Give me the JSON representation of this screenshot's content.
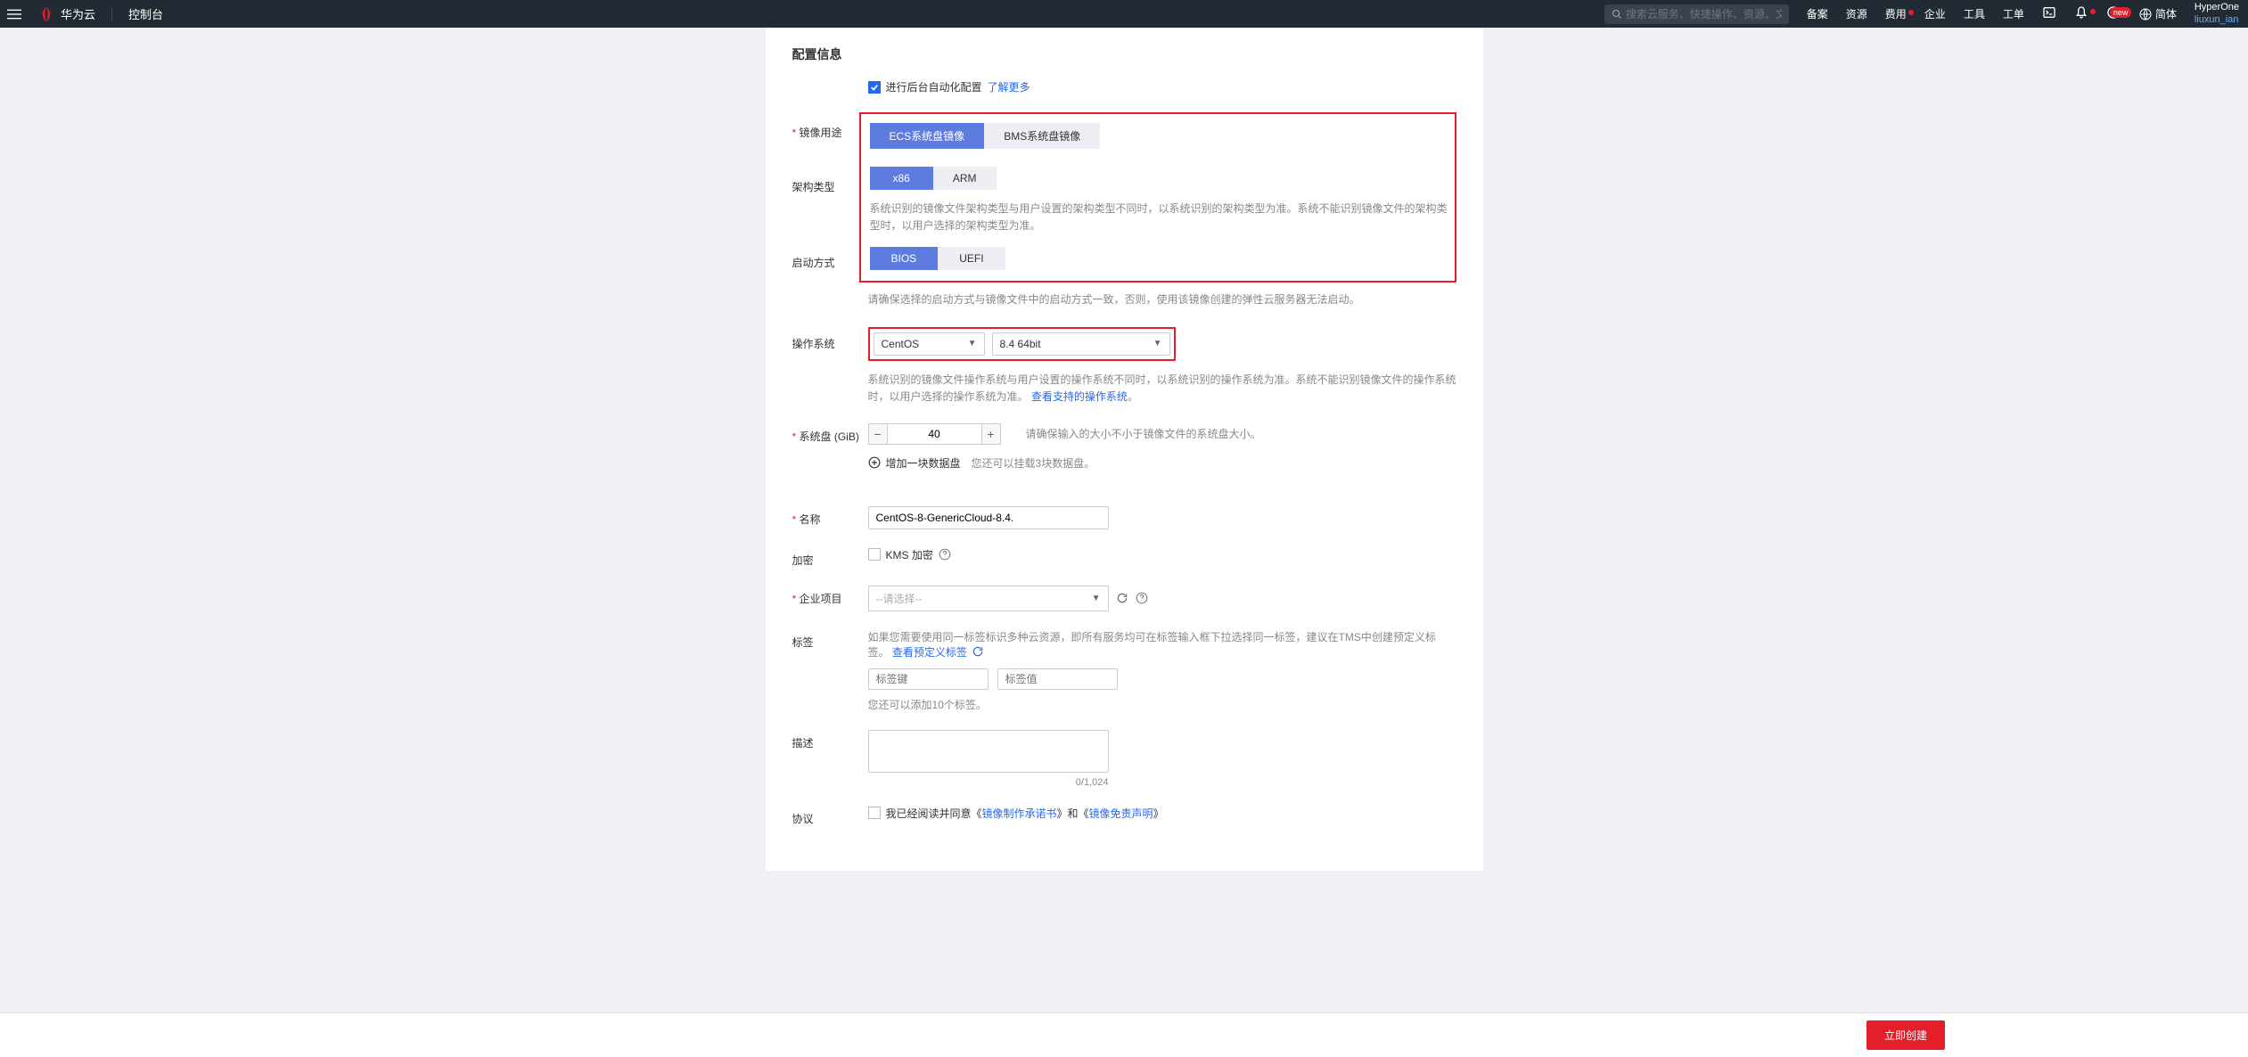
{
  "header": {
    "brand": "华为云",
    "console": "控制台",
    "search_placeholder": "搜索云服务、快捷操作、资源、文档、API",
    "nav": {
      "beian": "备案",
      "resource": "资源",
      "fee": "费用",
      "enterprise": "企业",
      "tool": "工具",
      "workorder": "工单",
      "new_badge": "new",
      "lang": "简体"
    },
    "user": {
      "line1": "HyperOne",
      "line2": "liuxun_ian"
    }
  },
  "section_title": "配置信息",
  "auto_config": {
    "label": "进行后台自动化配置",
    "learn_more": "了解更多"
  },
  "fields": {
    "image_use": {
      "label": "镜像用途",
      "opt1": "ECS系统盘镜像",
      "opt2": "BMS系统盘镜像"
    },
    "arch": {
      "label": "架构类型",
      "opt1": "x86",
      "opt2": "ARM",
      "note": "系统识别的镜像文件架构类型与用户设置的架构类型不同时，以系统识别的架构类型为准。系统不能识别镜像文件的架构类型时，以用户选择的架构类型为准。"
    },
    "boot": {
      "label": "启动方式",
      "opt1": "BIOS",
      "opt2": "UEFI",
      "note": "请确保选择的启动方式与镜像文件中的启动方式一致，否则，使用该镜像创建的弹性云服务器无法启动。"
    },
    "os": {
      "label": "操作系统",
      "select1": "CentOS",
      "select2": "8.4 64bit",
      "note1": "系统识别的镜像文件操作系统与用户设置的操作系统不同时，以系统识别的操作系统为准。系统不能识别镜像文件的操作系统时，以用户选择的操作系统为准。",
      "note_link": "查看支持的操作系统",
      "note2": "。"
    },
    "disk": {
      "label": "系统盘 (GiB)",
      "value": "40",
      "note": "请确保输入的大小不小于镜像文件的系统盘大小。",
      "add": "增加一块数据盘",
      "add_note": "您还可以挂载3块数据盘。"
    },
    "name": {
      "label": "名称",
      "value": "CentOS-8-GenericCloud-8.4."
    },
    "encrypt": {
      "label": "加密",
      "kms": "KMS 加密"
    },
    "enterprise": {
      "label": "企业项目",
      "placeholder": "--请选择--"
    },
    "tag": {
      "label": "标签",
      "note": "如果您需要使用同一标签标识多种云资源，即所有服务均可在标签输入框下拉选择同一标签，建议在TMS中创建预定义标签。",
      "link": "查看预定义标签",
      "key_ph": "标签键",
      "val_ph": "标签值",
      "limit": "您还可以添加10个标签。"
    },
    "desc": {
      "label": "描述",
      "count": "0/1,024"
    },
    "agreement": {
      "label": "协议",
      "text1": "我已经阅读并同意《",
      "link1": "镜像制作承诺书",
      "text2": "》和《",
      "link2": "镜像免责声明",
      "text3": "》"
    }
  },
  "footer": {
    "create": "立即创建"
  }
}
